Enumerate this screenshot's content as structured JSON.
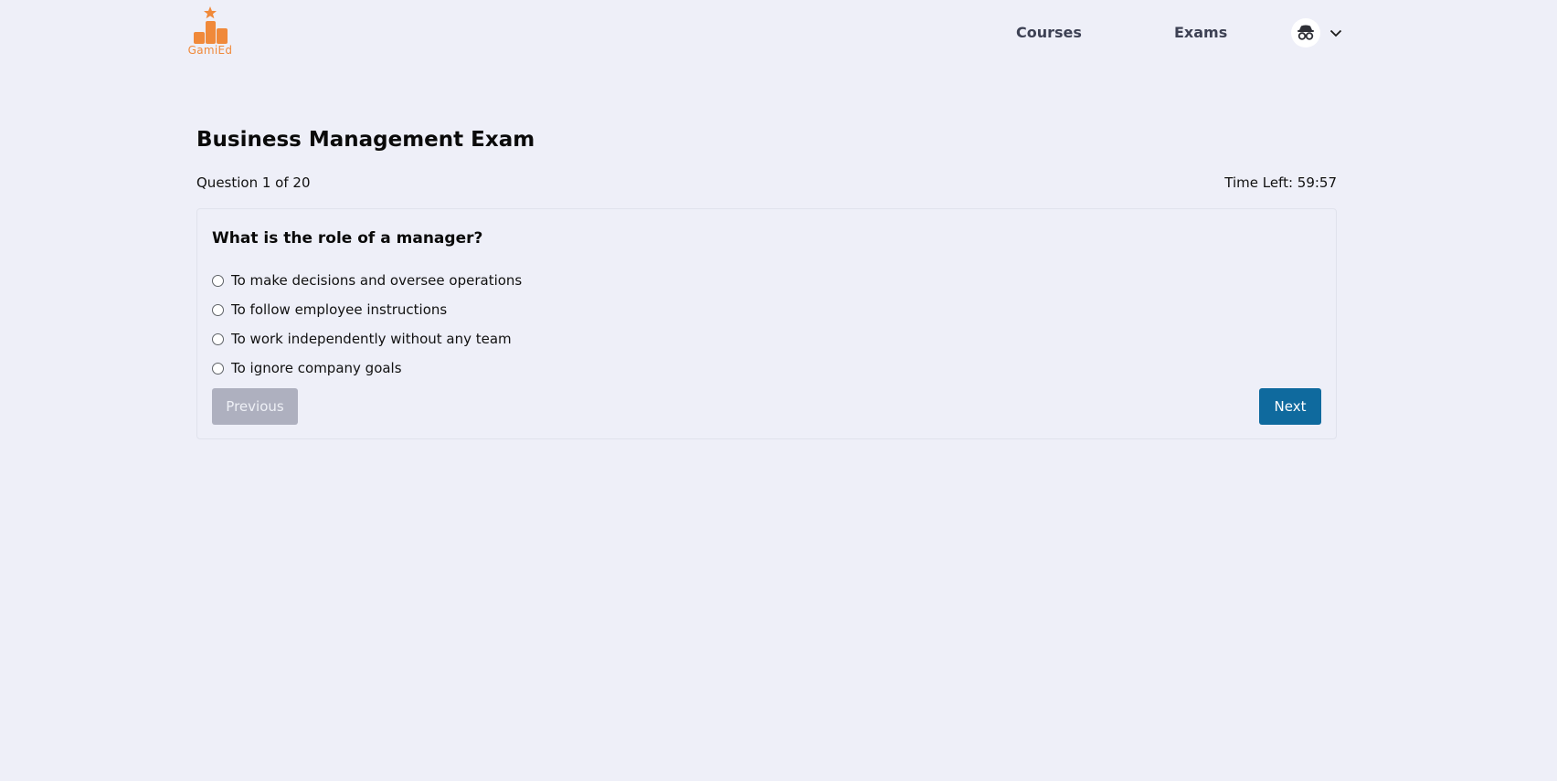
{
  "header": {
    "logo_text": "GamiEd",
    "nav": {
      "courses": "Courses",
      "exams": "Exams"
    },
    "profile": {
      "avatar_icon": "incognito-icon",
      "dropdown_icon": "chevron-down-icon"
    }
  },
  "exam": {
    "title": "Business Management Exam",
    "question_counter": "Question 1 of 20",
    "time_left": "Time Left: 59:57",
    "question": "What is the role of a manager?",
    "options": [
      "To make decisions and oversee operations",
      "To follow employee instructions",
      "To work independently without any team",
      "To ignore company goals"
    ],
    "buttons": {
      "previous": "Previous",
      "next": "Next"
    }
  },
  "colors": {
    "background": "#eeeff8",
    "brand_orange": "#f0893a",
    "primary_button": "#0f6a9e",
    "disabled_button": "#aeb0bf"
  }
}
